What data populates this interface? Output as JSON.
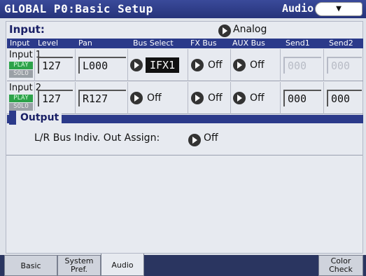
{
  "header": {
    "title": "GLOBAL P0:Basic Setup",
    "tab_name": "Audio",
    "menu_icon": "chevron-down-icon"
  },
  "input_section": {
    "label": "Input:",
    "source": "Analog",
    "columns": [
      "Input",
      "Level",
      "Pan",
      "Bus Select",
      "FX Bus",
      "AUX Bus",
      "Send1",
      "Send2"
    ],
    "rows": [
      {
        "name": "Input 1",
        "play": "PLAY",
        "solo": "SOLO",
        "level": "127",
        "pan": "L000",
        "bus_select": "IFX1",
        "fx_bus": "Off",
        "aux_bus": "Off",
        "send1": "000",
        "send2": "000"
      },
      {
        "name": "Input 2",
        "play": "PLAY",
        "solo": "SOLO",
        "level": "127",
        "pan": "R127",
        "bus_select": "Off",
        "fx_bus": "Off",
        "aux_bus": "Off",
        "send1": "000",
        "send2": "000"
      }
    ]
  },
  "output_section": {
    "label": "Output",
    "lr_assign_label": "L/R Bus Indiv. Out Assign:",
    "lr_assign_value": "Off"
  },
  "tabs": [
    {
      "label": "Basic"
    },
    {
      "label": "System Pref."
    },
    {
      "label": "Audio"
    },
    {
      "label": "Color Check"
    }
  ],
  "colors": {
    "title_bar": "#26337a",
    "table_header": "#2b3a8a",
    "play": "#2da24a",
    "solo": "#9aa0a6"
  }
}
